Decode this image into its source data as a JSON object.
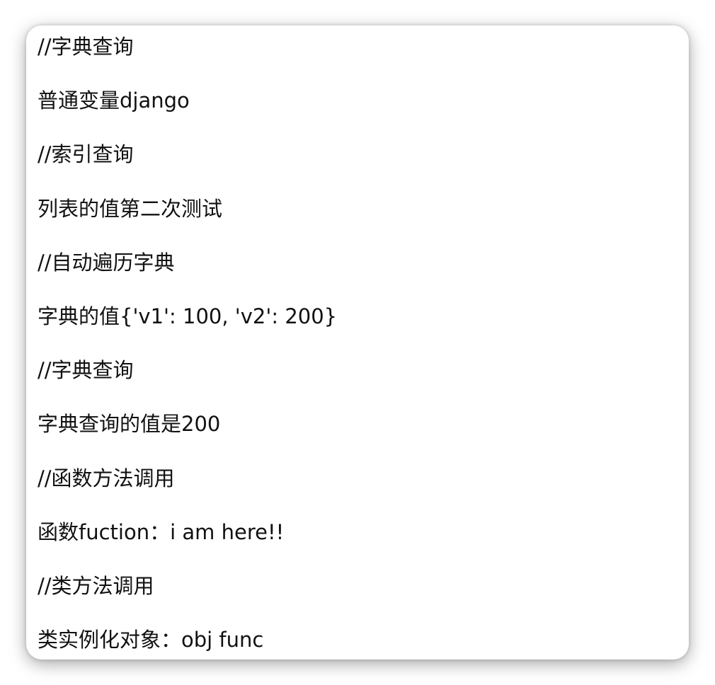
{
  "lines": [
    "//字典查询",
    "普通变量django",
    "//索引查询",
    "列表的值第二次测试",
    "//自动遍历字典",
    "字典的值{'v1': 100, 'v2': 200}",
    "//字典查询",
    "字典查询的值是200",
    "//函数方法调用",
    "函数fuction：i am here!!",
    "//类方法调用",
    "类实例化对象：obj func"
  ]
}
